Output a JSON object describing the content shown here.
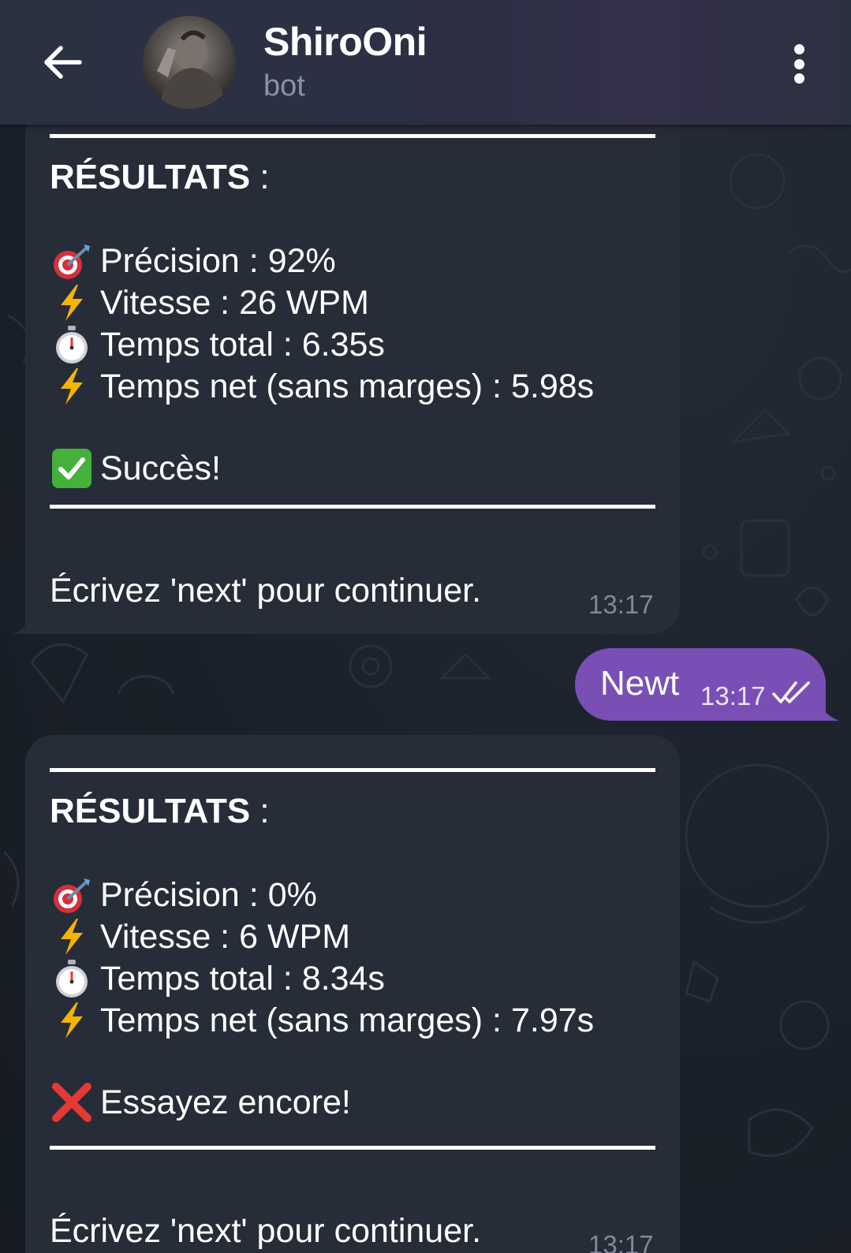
{
  "header": {
    "title": "ShiroOni",
    "subtitle": "bot"
  },
  "messages": [
    {
      "results_label": "RÉSULTATS",
      "results_colon": " :",
      "stats": [
        {
          "icon": "target-icon",
          "text": "Précision : 92%"
        },
        {
          "icon": "lightning-icon",
          "text": "Vitesse : 26 WPM"
        },
        {
          "icon": "stopwatch-icon",
          "text": "Temps total : 6.35s"
        },
        {
          "icon": "lightning-icon",
          "text": "Temps net (sans marges) : 5.98s"
        }
      ],
      "status": {
        "icon": "check-mark-icon",
        "text": "Succès!"
      },
      "footer": "Écrivez 'next' pour continuer.",
      "time": "13:17"
    },
    {
      "results_label": "RÉSULTATS",
      "results_colon": " :",
      "stats": [
        {
          "icon": "target-icon",
          "text": "Précision : 0%"
        },
        {
          "icon": "lightning-icon",
          "text": "Vitesse : 6 WPM"
        },
        {
          "icon": "stopwatch-icon",
          "text": "Temps total : 8.34s"
        },
        {
          "icon": "lightning-icon",
          "text": "Temps net (sans marges) : 7.97s"
        }
      ],
      "status": {
        "icon": "cross-mark-icon",
        "text": "Essayez encore!"
      },
      "footer": "Écrivez 'next' pour continuer.",
      "time": "13:17"
    }
  ],
  "outgoing": {
    "text": "Newt",
    "time": "13:17",
    "status_icon": "double-check-icon"
  },
  "colors": {
    "outgoing_bubble": "#7a4fb5",
    "incoming_bubble": "#262d38",
    "header": "#2a3242"
  }
}
